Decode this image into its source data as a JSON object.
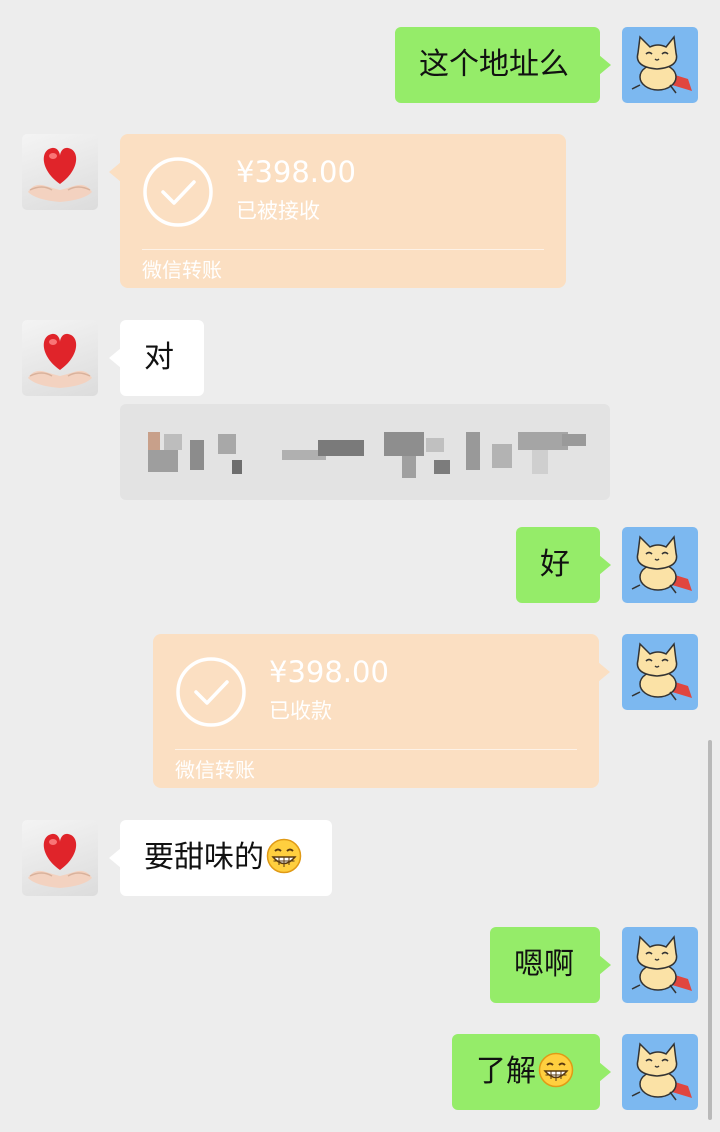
{
  "chat": {
    "messages": [
      {
        "sender": "me",
        "type": "text",
        "text": "这个地址么"
      },
      {
        "sender": "other",
        "type": "transfer",
        "amount": "¥398.00",
        "status": "已被接收",
        "footer": "微信转账"
      },
      {
        "sender": "other",
        "type": "text",
        "text": "对"
      },
      {
        "sender": "other",
        "type": "text-redacted",
        "text": ""
      },
      {
        "sender": "me",
        "type": "text",
        "text": "好"
      },
      {
        "sender": "me",
        "type": "transfer",
        "amount": "¥398.00",
        "status": "已收款",
        "footer": "微信转账"
      },
      {
        "sender": "other",
        "type": "text",
        "text": "要甜味的",
        "emoji": "grinning-face-emoji"
      },
      {
        "sender": "me",
        "type": "text",
        "text": "嗯啊"
      },
      {
        "sender": "me",
        "type": "text",
        "text": "了解",
        "emoji": "grinning-face-emoji"
      }
    ]
  },
  "avatars": {
    "me": "cartoon-cat-avatar",
    "other": "heart-in-hands-avatar"
  },
  "colors": {
    "background": "#ededed",
    "my_bubble": "#95ec69",
    "other_bubble": "#ffffff",
    "transfer_card": "#fbdfc2"
  }
}
